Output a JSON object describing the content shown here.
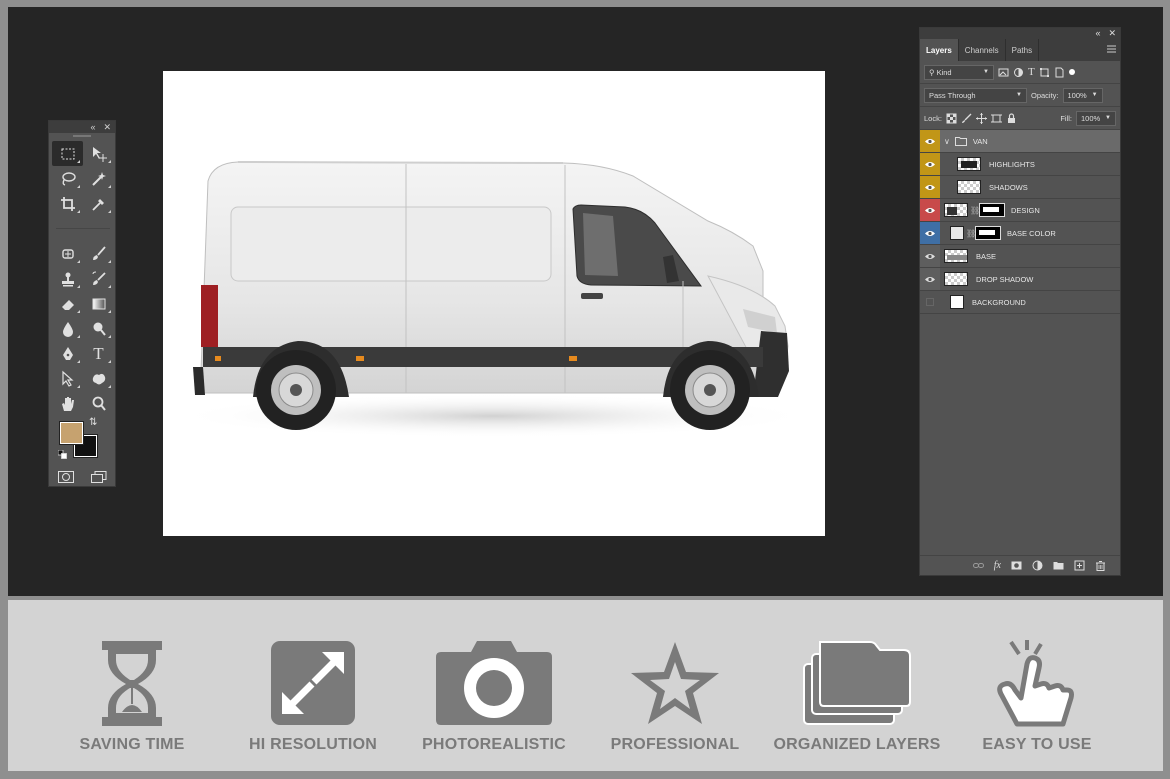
{
  "colors": {
    "workspace_bg": "#252525",
    "panel_bg": "#535353",
    "panel_header": "#3d3d3d",
    "foreground_color": "#c6a26f",
    "background_color": "#111111",
    "feature_icon": "#7a7a7a",
    "feature_band": "#d3d3d3",
    "visibility_yellow": "#c19617",
    "visibility_red": "#c84a4a",
    "visibility_blue": "#3f6fa5",
    "visibility_gray": "#777777"
  },
  "tools_panel": {
    "collapse_icon": "double-chevron-left-icon",
    "close_icon": "close-icon",
    "tools": [
      "rectangular-marquee-icon",
      "move-icon",
      "lasso-icon",
      "magic-wand-icon",
      "crop-icon",
      "eyedropper-icon",
      "healing-brush-icon",
      "brush-icon",
      "clone-stamp-icon",
      "history-brush-icon",
      "eraser-icon",
      "gradient-icon",
      "blur-icon",
      "dodge-icon",
      "pen-icon",
      "type-icon",
      "path-selection-icon",
      "custom-shape-icon",
      "hand-icon",
      "zoom-icon"
    ],
    "type_tool_glyph": "T"
  },
  "layers_panel": {
    "tabs": [
      "Layers",
      "Channels",
      "Paths"
    ],
    "active_tab": "Layers",
    "filter": {
      "label": "Kind"
    },
    "blend_mode": "Pass Through",
    "opacity_label": "Opacity:",
    "opacity_value": "100%",
    "lock_label": "Lock:",
    "fill_label": "Fill:",
    "fill_value": "100%",
    "layers": [
      {
        "name": "VAN",
        "kind": "group",
        "visibility": "yellow",
        "visible": true
      },
      {
        "name": "HIGHLIGHTS",
        "kind": "pixel",
        "visibility": "yellow",
        "visible": true
      },
      {
        "name": "SHADOWS",
        "kind": "pixel",
        "visibility": "yellow",
        "visible": true
      },
      {
        "name": "DESIGN",
        "kind": "smart-masked",
        "visibility": "red",
        "visible": true
      },
      {
        "name": "BASE COLOR",
        "kind": "fill-masked",
        "visibility": "blue",
        "visible": true
      },
      {
        "name": "BASE",
        "kind": "pixel",
        "visibility": "gray",
        "visible": true
      },
      {
        "name": "DROP SHADOW",
        "kind": "pixel",
        "visibility": "gray",
        "visible": true
      },
      {
        "name": "BACKGROUND",
        "kind": "pixel",
        "visibility": "gray",
        "visible": false
      }
    ],
    "footer_icons": [
      "link-layers-icon",
      "fx-icon",
      "add-mask-icon",
      "adjustment-layer-icon",
      "new-group-icon",
      "new-layer-icon",
      "delete-icon"
    ],
    "fx_glyph": "fx"
  },
  "features": [
    {
      "label": "SAVING TIME",
      "icon": "hourglass-icon"
    },
    {
      "label": "HI RESOLUTION",
      "icon": "expand-arrows-icon"
    },
    {
      "label": "PHOTOREALISTIC",
      "icon": "camera-icon"
    },
    {
      "label": "PROFESSIONAL",
      "icon": "star-icon"
    },
    {
      "label": "ORGANIZED LAYERS",
      "icon": "stacked-folders-icon"
    },
    {
      "label": "EASY TO USE",
      "icon": "pointing-hand-icon"
    }
  ]
}
